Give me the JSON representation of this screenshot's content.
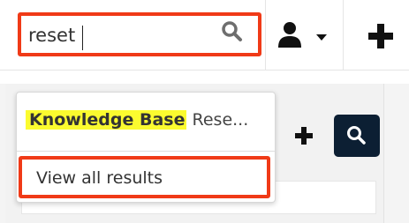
{
  "header": {
    "search": {
      "value": "reset",
      "placeholder": ""
    },
    "icons": {
      "search": "search-icon",
      "user": "user-icon",
      "caret": "caret-down-icon",
      "create": "plus-icon"
    }
  },
  "dropdown": {
    "results": [
      {
        "module": "Knowledge Base",
        "title": "Rese..."
      }
    ],
    "view_all_label": "View all results"
  },
  "colors": {
    "highlight": "#f03a17",
    "module_highlight": "#fbfb2f",
    "dark_button": "#0c1f33"
  }
}
